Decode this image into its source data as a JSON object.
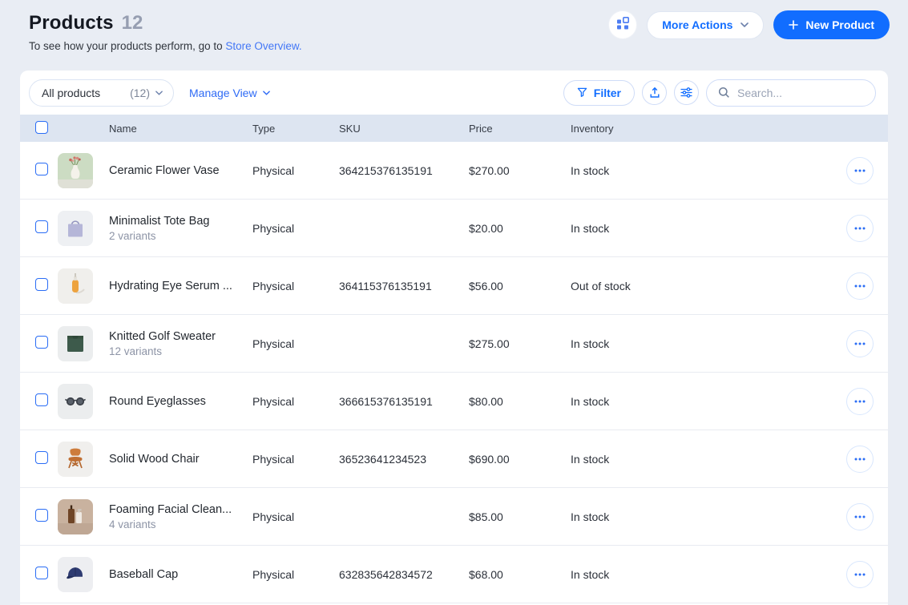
{
  "colors": {
    "primary": "#116dff",
    "header_row_bg": "#dde5f1",
    "page_bg": "#e9edf4"
  },
  "page": {
    "title": "Products",
    "count": "12",
    "subtitle_prefix": "To see how your products perform, go to ",
    "subtitle_link": "Store Overview."
  },
  "header_actions": {
    "more_actions_label": "More Actions",
    "new_product_label": "New Product"
  },
  "toolbar": {
    "view_selector_label": "All products",
    "view_selector_count": "(12)",
    "manage_view_label": "Manage View",
    "filter_label": "Filter",
    "search_placeholder": "Search..."
  },
  "icons": {
    "header": [
      "apps-grid-icon",
      "chevron-down-icon",
      "plus-icon"
    ],
    "toolbar": [
      "filter-funnel-icon",
      "export-icon",
      "sliders-icon",
      "search-icon"
    ],
    "rows": [
      "ellipsis-icon"
    ]
  },
  "table": {
    "columns": [
      "Name",
      "Type",
      "SKU",
      "Price",
      "Inventory"
    ],
    "rows": [
      {
        "name": "Ceramic Flower Vase",
        "variants": "",
        "type": "Physical",
        "sku": "364215376135191",
        "price": "$270.00",
        "inventory": "In stock",
        "thumb": "vase"
      },
      {
        "name": "Minimalist Tote Bag",
        "variants": "2 variants",
        "type": "Physical",
        "sku": "",
        "price": "$20.00",
        "inventory": "In stock",
        "thumb": "tote"
      },
      {
        "name": "Hydrating Eye Serum ...",
        "variants": "",
        "type": "Physical",
        "sku": "364115376135191",
        "price": "$56.00",
        "inventory": "Out of stock",
        "thumb": "serum"
      },
      {
        "name": "Knitted Golf Sweater",
        "variants": "12 variants",
        "type": "Physical",
        "sku": "",
        "price": "$275.00",
        "inventory": "In stock",
        "thumb": "sweater"
      },
      {
        "name": "Round Eyeglasses",
        "variants": "",
        "type": "Physical",
        "sku": "366615376135191",
        "price": "$80.00",
        "inventory": "In stock",
        "thumb": "glasses"
      },
      {
        "name": "Solid Wood Chair",
        "variants": "",
        "type": "Physical",
        "sku": "36523641234523",
        "price": "$690.00",
        "inventory": "In stock",
        "thumb": "chair"
      },
      {
        "name": "Foaming Facial Clean...",
        "variants": "4 variants",
        "type": "Physical",
        "sku": "",
        "price": "$85.00",
        "inventory": "In stock",
        "thumb": "cleanser"
      },
      {
        "name": "Baseball Cap",
        "variants": "",
        "type": "Physical",
        "sku": "632835642834572",
        "price": "$68.00",
        "inventory": "In stock",
        "thumb": "cap"
      }
    ]
  }
}
